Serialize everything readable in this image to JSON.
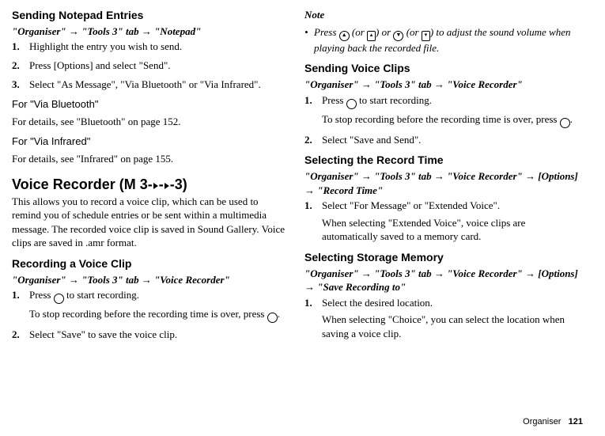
{
  "left": {
    "h1": "Sending Notepad Entries",
    "bc1_a": "\"Organiser\" ",
    "bc1_b": " \"Tools 3\" tab ",
    "bc1_c": " \"Notepad\"",
    "s1_n": "1.",
    "s1_t": "Highlight the entry you wish to send.",
    "s2_n": "2.",
    "s2_t": "Press [Options] and select \"Send\".",
    "s3_n": "3.",
    "s3_t": "Select \"As Message\", \"Via Bluetooth\" or \"Via Infrared\".",
    "bt_h": "For \"Via Bluetooth\"",
    "bt_t": "For details, see \"Bluetooth\" on page 152.",
    "ir_h": "For \"Via Infrared\"",
    "ir_t": "For details, see \"Infrared\" on page 155.",
    "vr_h_a": "Voice Recorder (M 3-",
    "vr_h_b": "-",
    "vr_h_c": "-3)",
    "vr_p": "This allows you to record a voice clip, which can be used to remind you of schedule entries or be sent within a multimedia message. The recorded voice clip is saved in Sound Gallery. Voice clips are saved in .amr format.",
    "rec_h": "Recording a Voice Clip",
    "bc2_a": "\"Organiser\" ",
    "bc2_b": " \"Tools 3\" tab ",
    "bc2_c": " \"Voice Recorder\"",
    "rec1_n": "1.",
    "rec1_t1": "Press ",
    "rec1_t2": " to start recording.",
    "rec1_t3": "To stop recording before the recording time is over, press ",
    "rec1_t4": ".",
    "rec2_n": "2.",
    "rec2_t": "Select \"Save\" to save the voice clip."
  },
  "right": {
    "note_h": "Note",
    "note_t1": "Press ",
    "note_t2": " (or ",
    "note_t3": ") or ",
    "note_t4": " (or ",
    "note_t5": ") to adjust the sound volume when playing back the recorded file.",
    "svc_h": "Sending Voice Clips",
    "bc3_a": "\"Organiser\" ",
    "bc3_b": " \"Tools 3\" tab ",
    "bc3_c": " \"Voice Recorder\"",
    "svc1_n": "1.",
    "svc1_t1": "Press ",
    "svc1_t2": " to start recording.",
    "svc1_t3": "To stop recording before the recording time is over, press ",
    "svc1_t4": ".",
    "svc2_n": "2.",
    "svc2_t": "Select \"Save and Send\".",
    "srt_h": "Selecting the Record Time",
    "bc4_a": "\"Organiser\" ",
    "bc4_b": " \"Tools 3\" tab ",
    "bc4_c": " \"Voice Recorder\" ",
    "bc4_d": " [Options] ",
    "bc4_e": " \"Record Time\"",
    "srt1_n": "1.",
    "srt1_t1": "Select \"For Message\" or \"Extended Voice\".",
    "srt1_t2": "When selecting \"Extended Voice\", voice clips are automatically saved to a memory card.",
    "ssm_h": "Selecting Storage Memory",
    "bc5_a": "\"Organiser\" ",
    "bc5_b": " \"Tools 3\" tab ",
    "bc5_c": " \"Voice Recorder\" ",
    "bc5_d": " [Options] ",
    "bc5_e": " \"Save Recording to\"",
    "ssm1_n": "1.",
    "ssm1_t1": "Select the desired location.",
    "ssm1_t2": "When selecting \"Choice\", you can select the location when saving a voice clip."
  },
  "footer": {
    "label": "Organiser",
    "page": "121"
  }
}
